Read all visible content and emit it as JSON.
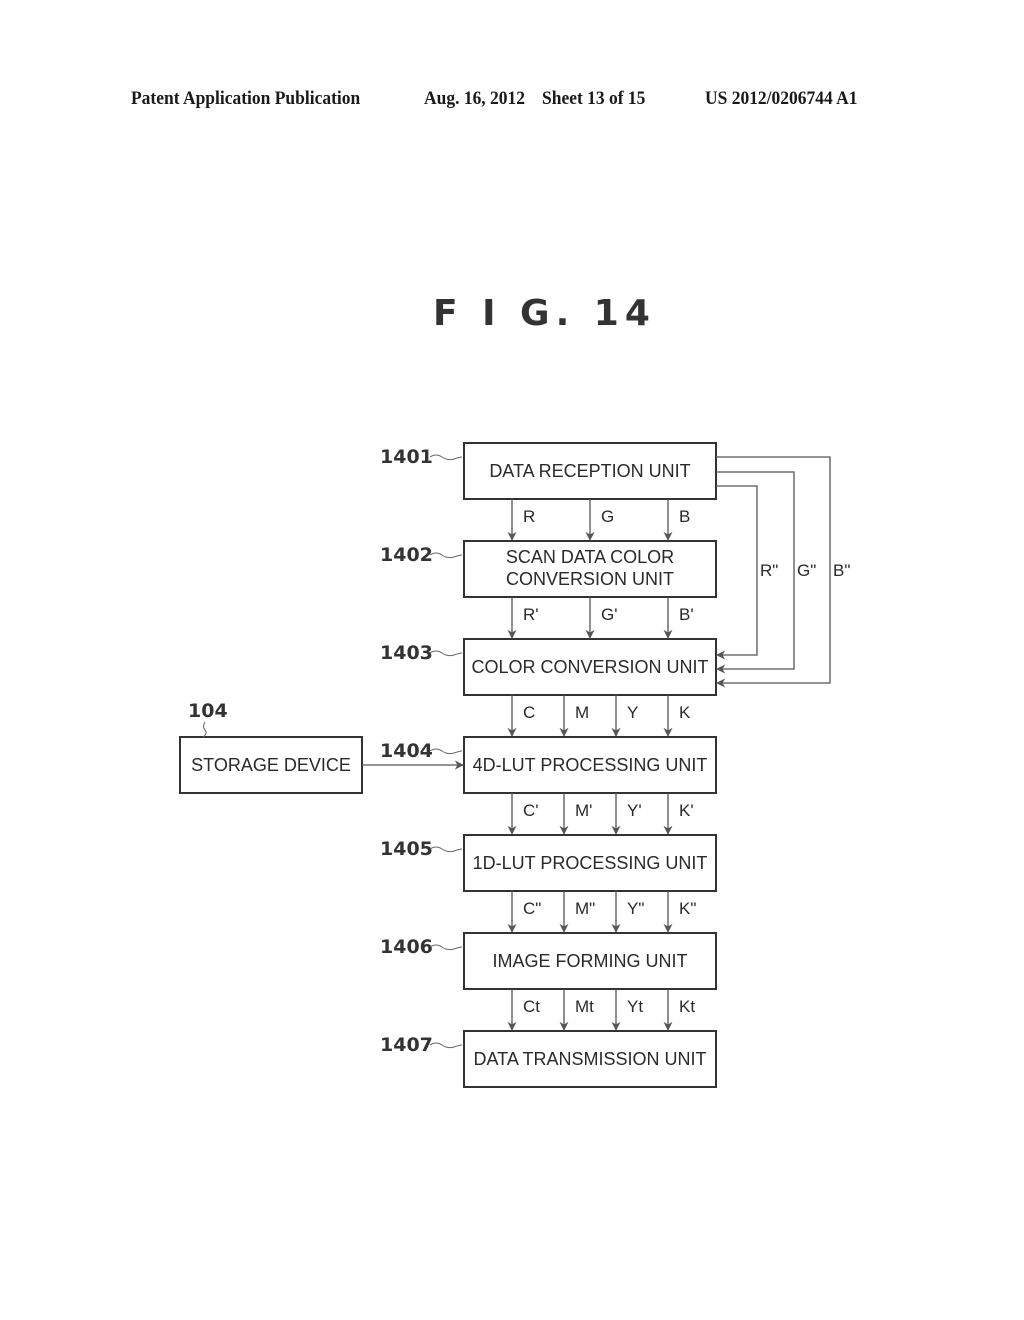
{
  "header": {
    "publication": "Patent Application Publication",
    "date": "Aug. 16, 2012",
    "sheet": "Sheet 13 of 15",
    "patent_number": "US 2012/0206744 A1"
  },
  "figure": {
    "title": "F I G. 14",
    "blocks": [
      {
        "ref": "1401",
        "lines": [
          "DATA RECEPTION UNIT"
        ]
      },
      {
        "ref": "1402",
        "lines": [
          "SCAN DATA COLOR",
          "CONVERSION UNIT"
        ]
      },
      {
        "ref": "1403",
        "lines": [
          "COLOR CONVERSION UNIT"
        ]
      },
      {
        "ref": "1404",
        "lines": [
          "4D-LUT PROCESSING UNIT"
        ]
      },
      {
        "ref": "1405",
        "lines": [
          "1D-LUT PROCESSING UNIT"
        ]
      },
      {
        "ref": "1406",
        "lines": [
          "IMAGE FORMING UNIT"
        ]
      },
      {
        "ref": "1407",
        "lines": [
          "DATA TRANSMISSION UNIT"
        ]
      }
    ],
    "storage": {
      "ref": "104",
      "label": "STORAGE DEVICE"
    },
    "signals": [
      [
        "R",
        "G",
        "B"
      ],
      [
        "R'",
        "G'",
        "B'"
      ],
      [
        "C",
        "M",
        "Y",
        "K"
      ],
      [
        "C'",
        "M'",
        "Y'",
        "K'"
      ],
      [
        "C\"",
        "M\"",
        "Y\"",
        "K\""
      ],
      [
        "Ct",
        "Mt",
        "Yt",
        "Kt"
      ]
    ],
    "bypass_signals": [
      "R\"",
      "G\"",
      "B\""
    ]
  }
}
